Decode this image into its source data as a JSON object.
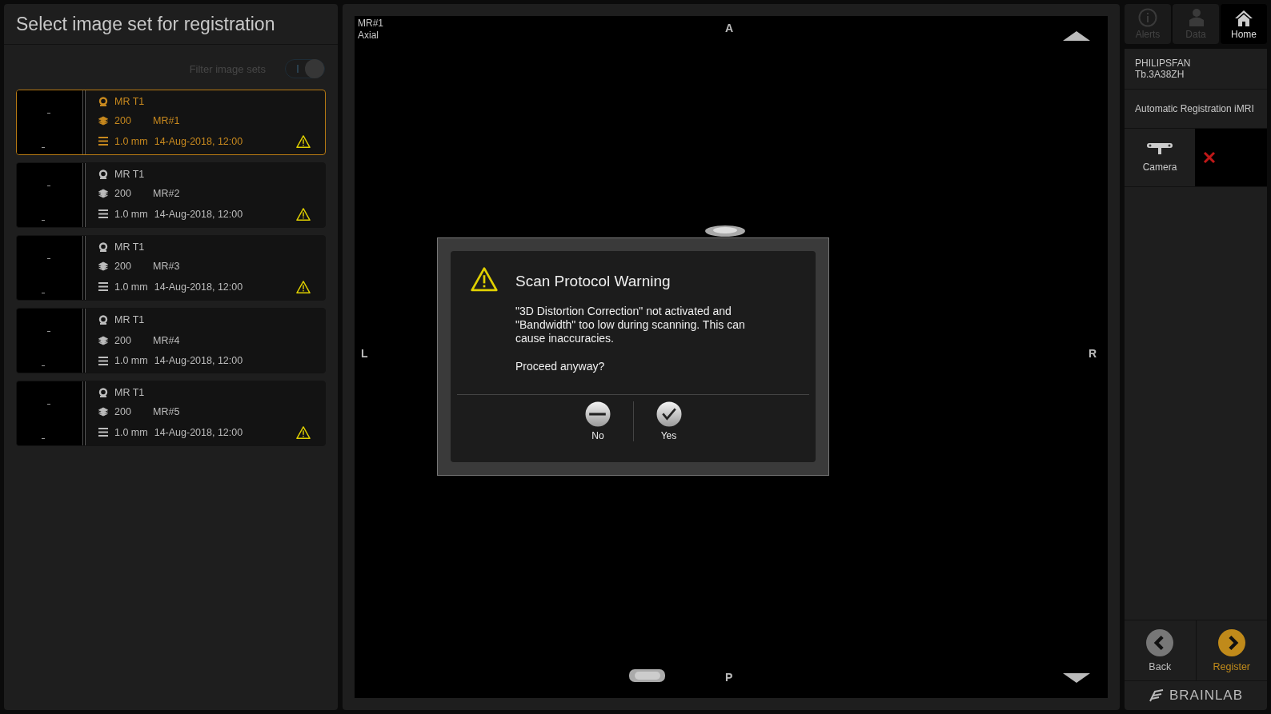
{
  "left_panel": {
    "title": "Select image set for registration",
    "filter": {
      "label": "Filter image sets",
      "disabled": true
    },
    "image_sets": [
      {
        "modality": "MR T1",
        "slices": "200",
        "name": "MR#1",
        "thickness": "1.0 mm",
        "date": "14-Aug-2018, 12:00",
        "selected": true,
        "warning": true
      },
      {
        "modality": "MR T1",
        "slices": "200",
        "name": "MR#2",
        "thickness": "1.0 mm",
        "date": "14-Aug-2018, 12:00",
        "selected": false,
        "warning": true
      },
      {
        "modality": "MR T1",
        "slices": "200",
        "name": "MR#3",
        "thickness": "1.0 mm",
        "date": "14-Aug-2018, 12:00",
        "selected": false,
        "warning": true
      },
      {
        "modality": "MR T1",
        "slices": "200",
        "name": "MR#4",
        "thickness": "1.0 mm",
        "date": "14-Aug-2018, 12:00",
        "selected": false,
        "warning": false
      },
      {
        "modality": "MR T1",
        "slices": "200",
        "name": "MR#5",
        "thickness": "1.0 mm",
        "date": "14-Aug-2018, 12:00",
        "selected": false,
        "warning": true
      }
    ]
  },
  "viewer": {
    "series": "MR#1",
    "plane": "Axial",
    "top": "A",
    "left": "L",
    "right": "R",
    "bottom": "P"
  },
  "dialog": {
    "title": "Scan Protocol Warning",
    "message": "\"3D Distortion Correction\" not activated and \"Bandwidth\" too low during scanning. This can cause inaccuracies.",
    "question": "Proceed anyway?",
    "buttons": [
      {
        "kind": "no",
        "label": "No"
      },
      {
        "kind": "yes",
        "label": "Yes"
      }
    ]
  },
  "right_panel": {
    "tabs": [
      {
        "kind": "alerts",
        "label": "Alerts",
        "disabled": true,
        "selected": false
      },
      {
        "kind": "data",
        "label": "Data",
        "disabled": true,
        "selected": false
      },
      {
        "kind": "home",
        "label": "Home",
        "disabled": false,
        "selected": true
      }
    ],
    "patient": [
      "PHILIPSFAN",
      "Tb.3A38ZH"
    ],
    "workflow": "Automatic Registration iMRI",
    "camera": {
      "label": "Camera",
      "connected": false
    },
    "nav": [
      {
        "kind": "back",
        "label": "Back"
      },
      {
        "kind": "register",
        "label": "Register"
      }
    ],
    "logo": "BRAINLAB"
  }
}
